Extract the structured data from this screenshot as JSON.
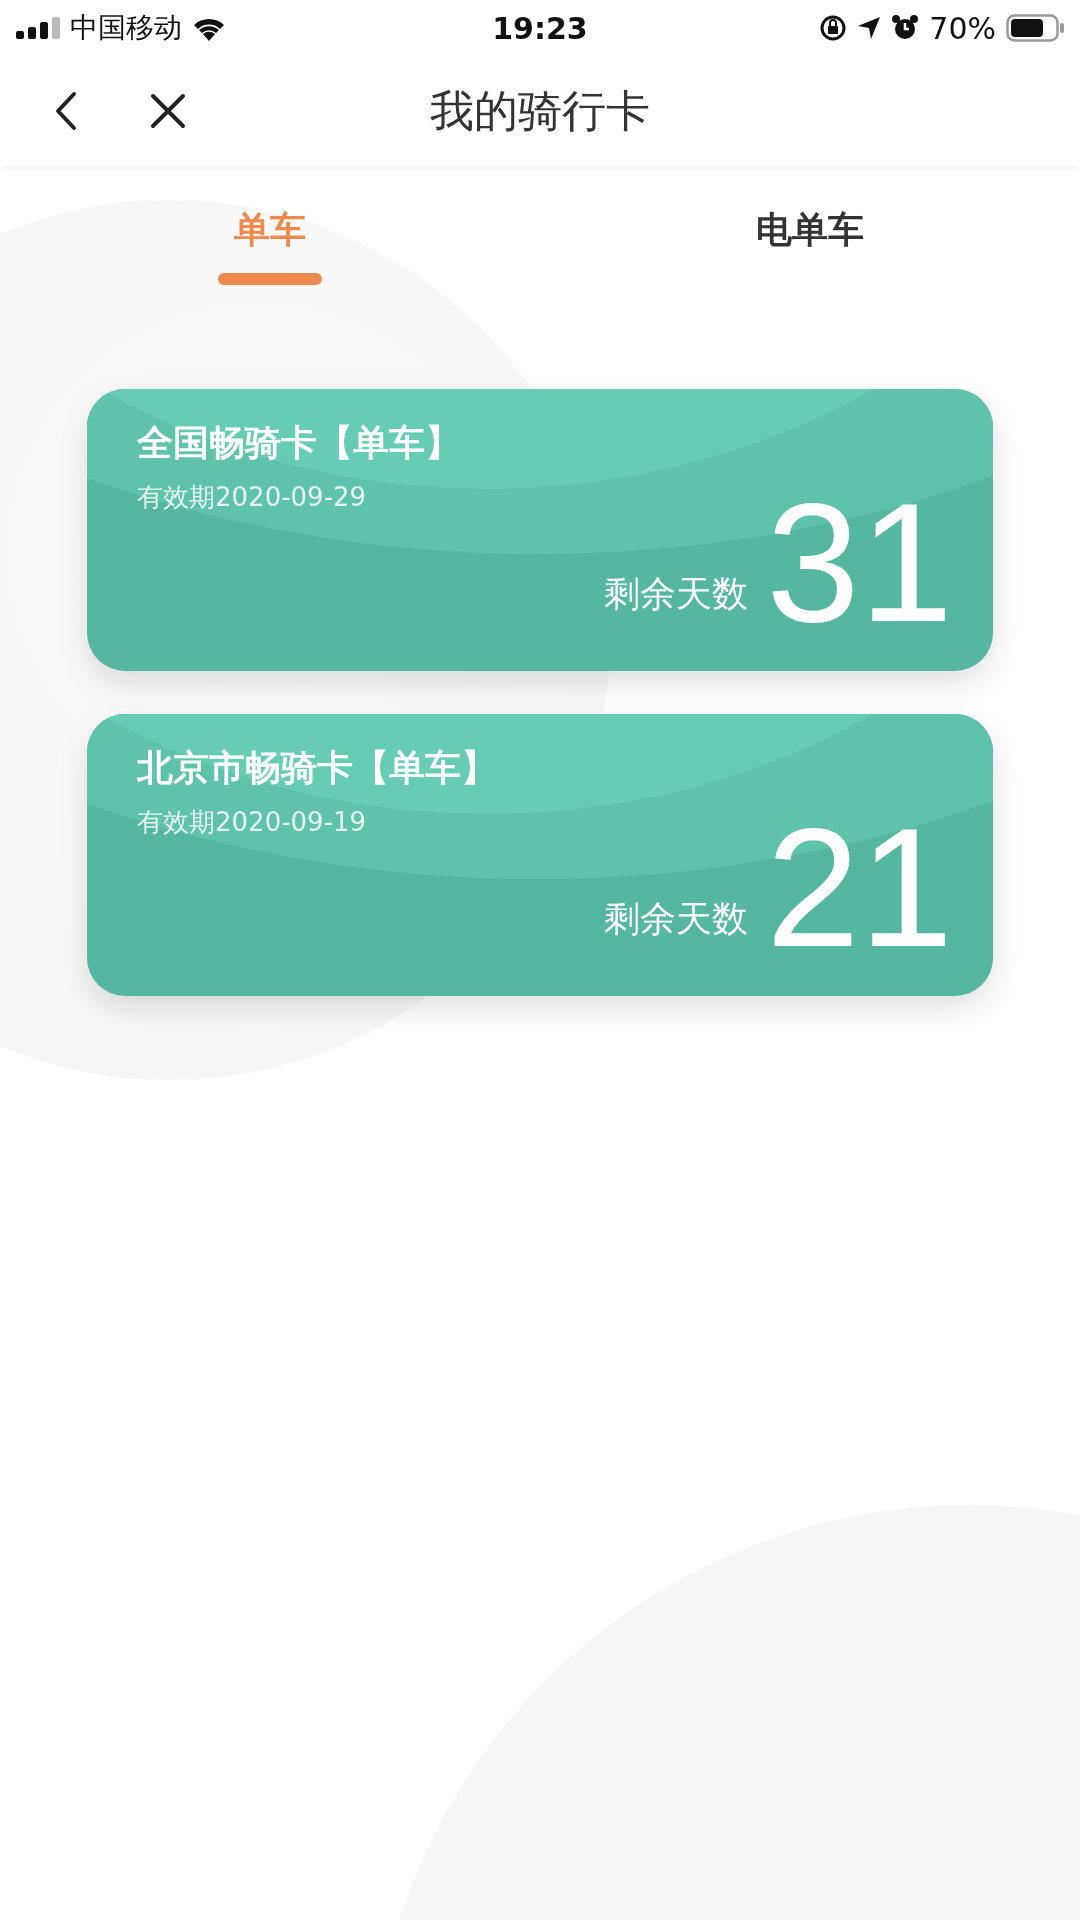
{
  "status_bar": {
    "carrier": "中国移动",
    "time": "19:23",
    "battery": "70%"
  },
  "nav": {
    "title": "我的骑行卡"
  },
  "tabs": [
    {
      "label": "单车",
      "selected": true
    },
    {
      "label": "电单车",
      "selected": false
    }
  ],
  "cards": [
    {
      "title": "全国畅骑卡【单车】",
      "validity": "有效期2020-09-29",
      "remaining_label": "剩余天数",
      "days": "31"
    },
    {
      "title": "北京市畅骑卡【单车】",
      "validity": "有效期2020-09-19",
      "remaining_label": "剩余天数",
      "days": "21"
    }
  ]
}
